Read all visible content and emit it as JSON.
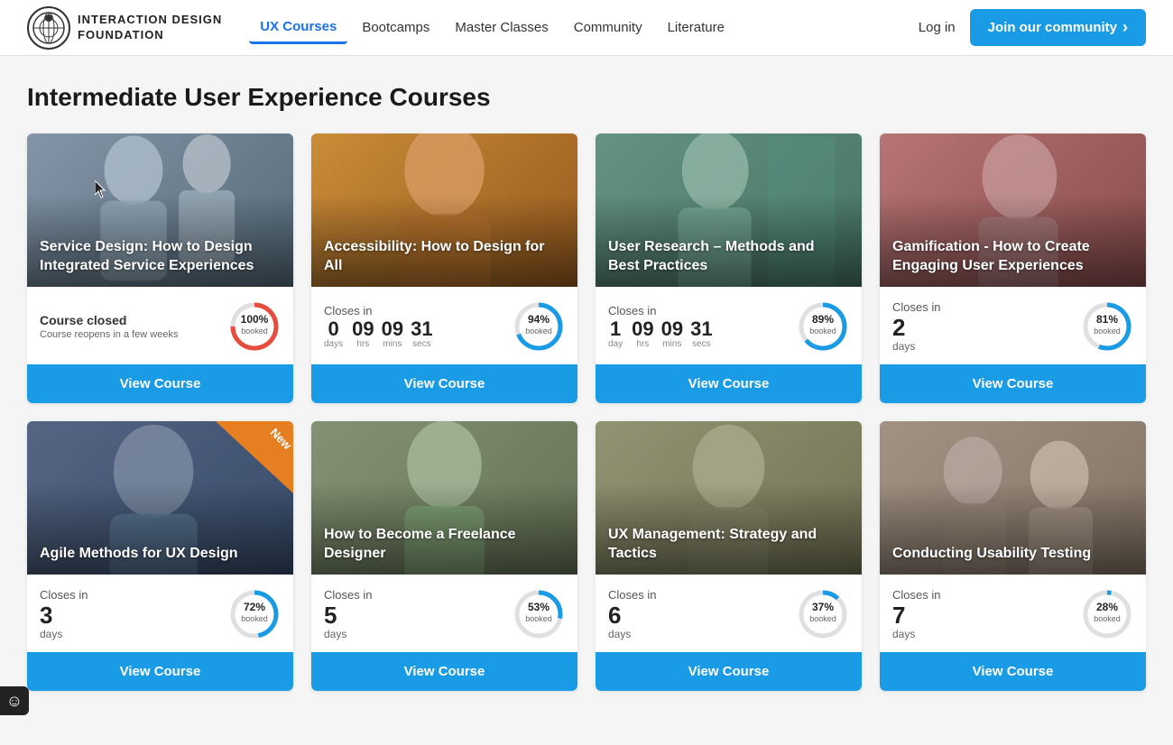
{
  "nav": {
    "logo_line1": "INTERACTION DESIGN",
    "logo_line2": "FOUNDATION",
    "links": [
      {
        "label": "UX Courses",
        "active": true
      },
      {
        "label": "Bootcamps",
        "active": false
      },
      {
        "label": "Master Classes",
        "active": false
      },
      {
        "label": "Community",
        "active": false
      },
      {
        "label": "Literature",
        "active": false
      }
    ],
    "login": "Log in",
    "join": "Join our community"
  },
  "section_title": "Intermediate User Experience Courses",
  "courses_row1": [
    {
      "id": "service-design",
      "title": "Service Design: How to Design Integrated Service Experiences",
      "bg_color": "#7a8fa0",
      "status_type": "closed",
      "closed_label": "Course closed",
      "reopens_label": "Course reopens in a few weeks",
      "percent": 100,
      "btn_label": "View Course",
      "new": false
    },
    {
      "id": "accessibility",
      "title": "Accessibility: How to Design for All",
      "bg_color": "#c0873a",
      "status_type": "countdown",
      "closes_label": "Closes in",
      "days": "0",
      "days_unit": "days",
      "hrs": "09",
      "mins": "09",
      "secs": "31",
      "percent": 94,
      "btn_label": "View Course",
      "new": false
    },
    {
      "id": "user-research",
      "title": "User Research – Methods and Best Practices",
      "bg_color": "#6a8a6a",
      "status_type": "countdown",
      "closes_label": "Closes in",
      "days": "1",
      "days_unit": "day",
      "hrs": "09",
      "mins": "09",
      "secs": "31",
      "percent": 89,
      "btn_label": "View Course",
      "new": false
    },
    {
      "id": "gamification",
      "title": "Gamification - How to Create Engaging User Experiences",
      "bg_color": "#b06a6a",
      "status_type": "days_only",
      "closes_label": "Closes in",
      "days": "2",
      "days_unit": "days",
      "percent": 81,
      "btn_label": "View Course",
      "new": false
    }
  ],
  "courses_row2": [
    {
      "id": "agile-methods",
      "title": "Agile Methods for UX Design",
      "bg_color": "#5a6a7a",
      "status_type": "days_only",
      "closes_label": "Closes in",
      "days": "3",
      "days_unit": "days",
      "percent": 72,
      "btn_label": "View Course",
      "new": true
    },
    {
      "id": "freelance-designer",
      "title": "How to Become a Freelance Designer",
      "bg_color": "#7a8a6a",
      "status_type": "days_only",
      "closes_label": "Closes in",
      "days": "5",
      "days_unit": "days",
      "percent": 53,
      "btn_label": "View Course",
      "new": false
    },
    {
      "id": "ux-management",
      "title": "UX Management: Strategy and Tactics",
      "bg_color": "#8a8a7a",
      "status_type": "days_only",
      "closes_label": "Closes in",
      "days": "6",
      "days_unit": "days",
      "percent": 37,
      "btn_label": "View Course",
      "new": false
    },
    {
      "id": "usability-testing",
      "title": "Conducting Usability Testing",
      "bg_color": "#9a8a7a",
      "status_type": "days_only",
      "closes_label": "Closes in",
      "days": "7",
      "days_unit": "days",
      "percent": 28,
      "btn_label": "View Course",
      "new": false
    }
  ],
  "booked_label": "booked",
  "accessibility_icon": "☺"
}
